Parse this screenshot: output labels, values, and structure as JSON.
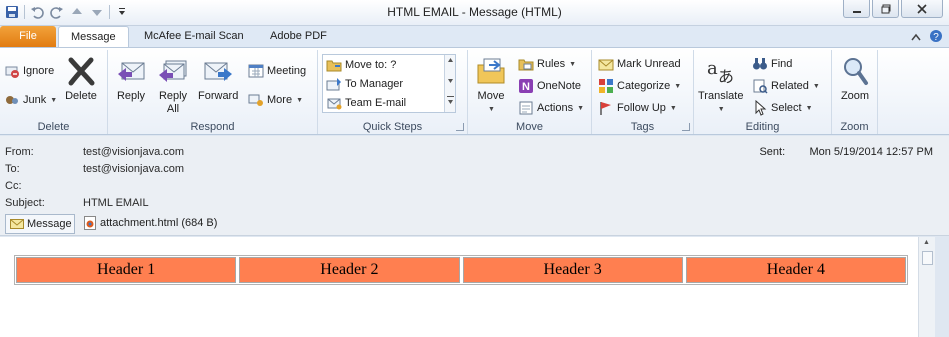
{
  "window": {
    "title": "HTML EMAIL  -  Message (HTML)"
  },
  "tabs": {
    "file": "File",
    "message": "Message",
    "mcafee": "McAfee E-mail Scan",
    "adobe": "Adobe PDF"
  },
  "ribbon": {
    "delete_group": {
      "label": "Delete",
      "ignore": "Ignore",
      "junk": "Junk",
      "delete": "Delete"
    },
    "respond_group": {
      "label": "Respond",
      "reply": "Reply",
      "reply_all_1": "Reply",
      "reply_all_2": "All",
      "forward": "Forward",
      "meeting": "Meeting",
      "more": "More"
    },
    "quicksteps_group": {
      "label": "Quick Steps",
      "move_to": "Move to: ?",
      "to_manager": "To Manager",
      "team_email": "Team E-mail"
    },
    "move_group": {
      "label": "Move",
      "move": "Move",
      "rules": "Rules",
      "onenote": "OneNote",
      "actions": "Actions"
    },
    "tags_group": {
      "label": "Tags",
      "mark_unread": "Mark Unread",
      "categorize": "Categorize",
      "follow_up": "Follow Up"
    },
    "editing_group": {
      "label": "Editing",
      "translate": "Translate",
      "find": "Find",
      "related": "Related",
      "select": "Select"
    },
    "zoom_group": {
      "label": "Zoom",
      "zoom": "Zoom"
    }
  },
  "header": {
    "from_label": "From:",
    "from_value": "test@visionjava.com",
    "to_label": "To:",
    "to_value": "test@visionjava.com",
    "cc_label": "Cc:",
    "cc_value": "",
    "subject_label": "Subject:",
    "subject_value": "HTML EMAIL",
    "sent_label": "Sent:",
    "sent_value": "Mon 5/19/2014 12:57 PM"
  },
  "attachments": {
    "message_tab": "Message",
    "file": "attachment.html (684 B)"
  },
  "body": {
    "table_headers": [
      "Header 1",
      "Header 2",
      "Header 3",
      "Header 4"
    ]
  },
  "colors": {
    "file_tab": "#e07a10",
    "table_header": "#ff7f50"
  }
}
